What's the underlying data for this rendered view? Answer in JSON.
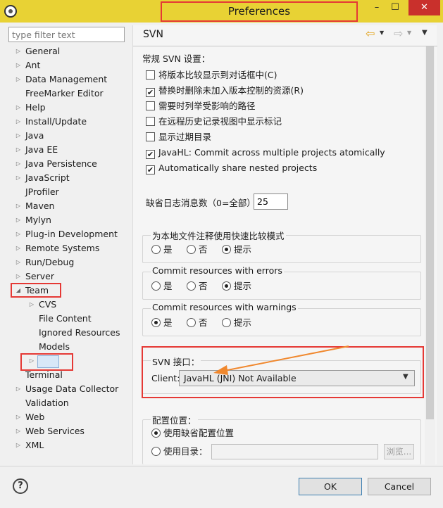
{
  "window": {
    "title": "Preferences",
    "minimize_glyph": "–",
    "maximize_glyph": "☐",
    "close_glyph": "✕"
  },
  "filter": {
    "placeholder": "type filter text"
  },
  "tree": {
    "items": [
      {
        "label": "General",
        "twisty": "▷"
      },
      {
        "label": "Ant",
        "twisty": "▷"
      },
      {
        "label": "Data Management",
        "twisty": "▷"
      },
      {
        "label": "FreeMarker Editor",
        "twisty": ""
      },
      {
        "label": "Help",
        "twisty": "▷"
      },
      {
        "label": "Install/Update",
        "twisty": "▷"
      },
      {
        "label": "Java",
        "twisty": "▷"
      },
      {
        "label": "Java EE",
        "twisty": "▷"
      },
      {
        "label": "Java Persistence",
        "twisty": "▷"
      },
      {
        "label": "JavaScript",
        "twisty": "▷"
      },
      {
        "label": "JProfiler",
        "twisty": ""
      },
      {
        "label": "Maven",
        "twisty": "▷"
      },
      {
        "label": "Mylyn",
        "twisty": "▷"
      },
      {
        "label": "Plug-in Development",
        "twisty": "▷"
      },
      {
        "label": "Remote Systems",
        "twisty": "▷"
      },
      {
        "label": "Run/Debug",
        "twisty": "▷"
      },
      {
        "label": "Server",
        "twisty": "▷"
      },
      {
        "label": "Team",
        "twisty": "◢"
      },
      {
        "label": "CVS",
        "twisty": "▷",
        "child": true
      },
      {
        "label": "File Content",
        "twisty": "",
        "child": true
      },
      {
        "label": "Ignored Resources",
        "twisty": "",
        "child": true
      },
      {
        "label": "Models",
        "twisty": "",
        "child": true
      },
      {
        "label": "SVN",
        "twisty": "▷",
        "child": true
      },
      {
        "label": "Terminal",
        "twisty": ""
      },
      {
        "label": "Usage Data Collector",
        "twisty": "▷"
      },
      {
        "label": "Validation",
        "twisty": ""
      },
      {
        "label": "Web",
        "twisty": "▷"
      },
      {
        "label": "Web Services",
        "twisty": "▷"
      },
      {
        "label": "XML",
        "twisty": "▷"
      }
    ]
  },
  "page": {
    "title": "SVN",
    "back_glyph": "⇦",
    "forward_glyph": "⇨",
    "dropdown_glyph": "▼",
    "general_label": "常规 SVN 设置：",
    "checkboxes": [
      {
        "label": "将版本比较显示到对话框中(C)",
        "checked": false
      },
      {
        "label": "替换时删除未加入版本控制的资源(R)",
        "checked": true
      },
      {
        "label": "需要时列举受影响的路径",
        "checked": false
      },
      {
        "label": "在远程历史记录视图中显示标记",
        "checked": false
      },
      {
        "label": "显示过期目录",
        "checked": false
      },
      {
        "label": "JavaHL: Commit across multiple projects atomically",
        "checked": true
      },
      {
        "label": "Automatically share nested projects",
        "checked": true
      }
    ],
    "check_glyph": "✔",
    "log_label": "缺省日志消息数（0=全部）",
    "log_value": "25",
    "groups": [
      {
        "title": "为本地文件注释使用快速比较模式",
        "options": [
          "是",
          "否",
          "提示"
        ],
        "selected": 2
      },
      {
        "title": "Commit resources with errors",
        "options": [
          "是",
          "否",
          "提示"
        ],
        "selected": 2
      },
      {
        "title": "Commit resources with warnings",
        "options": [
          "是",
          "否",
          "提示"
        ],
        "selected": 0
      }
    ],
    "svn_interface": {
      "title": "SVN 接口：",
      "client_label": "Client:",
      "client_value": "JavaHL (JNI) Not Available",
      "select_glyph": "⌵"
    },
    "config": {
      "title": "配置位置：",
      "use_default": "使用缺省配置位置",
      "use_dir": "使用目录：",
      "path_value": "",
      "browse": "浏览..."
    }
  },
  "footer": {
    "help_glyph": "?",
    "ok": "OK",
    "cancel": "Cancel"
  },
  "colors": {
    "title_bar": "#e8d234",
    "highlight_box": "#e53935",
    "arrow": "#f0882e"
  }
}
